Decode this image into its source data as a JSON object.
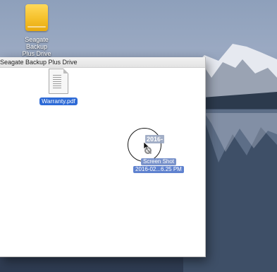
{
  "desktop": {
    "drive_label_line1": "Seagate Backup",
    "drive_label_line2": "Plus Drive"
  },
  "window": {
    "title": "Seagate Backup Plus Drive"
  },
  "files": {
    "pdf_name": "Warranty.pdf"
  },
  "drag": {
    "ghost_text": "2016-",
    "label_line1": "Screen Shot",
    "label_line2": "2016-02...6.25 PM"
  },
  "colors": {
    "selection": "#2d6ad6",
    "drive_yellow": "#f5c02a"
  }
}
